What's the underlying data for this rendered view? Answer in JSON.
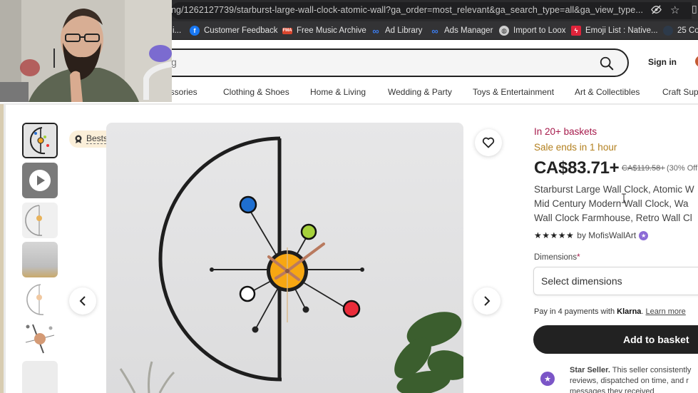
{
  "browser": {
    "url": "ng/1262127739/starburst-large-wall-clock-atomic-wall?ga_order=most_relevant&ga_search_type=all&ga_view_type...",
    "bookmarks": [
      {
        "label": "i...",
        "icon": "ellipsis"
      },
      {
        "label": "Customer Feedback",
        "icon": "facebook-icon"
      },
      {
        "label": "Free Music Archive",
        "icon": "fma-icon"
      },
      {
        "label": "Ad Library",
        "icon": "meta-icon"
      },
      {
        "label": "Ads Manager",
        "icon": "meta-icon"
      },
      {
        "label": "Import to Loox",
        "icon": "globe-icon"
      },
      {
        "label": "Emoji List : Native...",
        "icon": "bolt-icon"
      },
      {
        "label": "25 Co",
        "icon": "site-icon"
      }
    ]
  },
  "header": {
    "search_placeholder": "g",
    "sign_in": "Sign in",
    "categories": [
      "essories",
      "Clothing & Shoes",
      "Home & Living",
      "Wedding & Party",
      "Toys & Entertainment",
      "Art & Collectibles",
      "Craft Sup"
    ]
  },
  "gallery": {
    "badge": "Bestseller",
    "thumbnail_count": 7
  },
  "product": {
    "baskets": "In 20+ baskets",
    "sale": "Sale ends in 1 hour",
    "price": "CA$83.71+",
    "original_price": "CA$119.58+",
    "discount": "(30% Off",
    "title_lines": [
      "Starburst Large Wall Clock, Atomic W",
      "Mid Century Modern Wall Clock, Wa",
      "Wall Clock Farmhouse, Retro Wall Cl"
    ],
    "rating_stars": 5,
    "stars_text": "★★★★★",
    "shop": "by MofisWallArt",
    "dimensions_label": "Dimensions",
    "dimensions_required": "*",
    "dimensions_placeholder": "Select dimensions",
    "klarna_pre": "Pay in 4 payments with ",
    "klarna_brand": "Klarna",
    "klarna_post": ". ",
    "klarna_link": "Learn more",
    "add_to_basket": "Add to basket",
    "star_seller_title": "Star Seller.",
    "star_seller_lines": [
      " This seller consistently",
      "reviews, dispatched on time, and r",
      "messages they received"
    ]
  },
  "colors": {
    "baskets": "#a61a4b",
    "sale": "#b3801f",
    "button": "#222222",
    "star_seller": "#7b55c7"
  }
}
